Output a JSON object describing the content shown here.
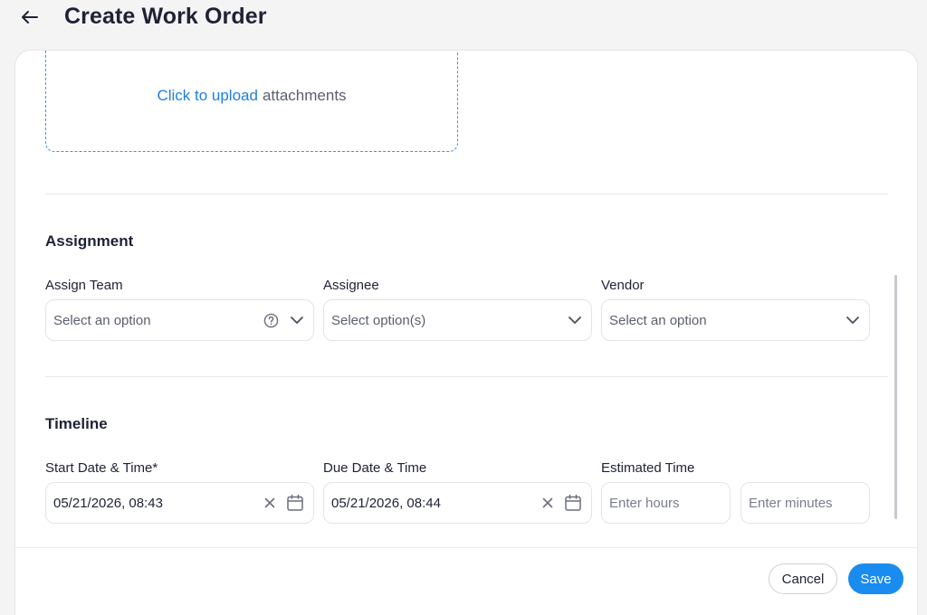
{
  "header": {
    "title": "Create Work Order",
    "back_icon": "arrow-left-icon"
  },
  "upload": {
    "link_text": "Click to upload",
    "rest_text": "attachments"
  },
  "assignment": {
    "title": "Assignment",
    "fields": [
      {
        "label": "Assign Team",
        "placeholder": "Select an option"
      },
      {
        "label": "Assignee",
        "placeholder": "Select option(s)"
      },
      {
        "label": "Vendor",
        "placeholder": "Select an option"
      }
    ]
  },
  "timeline": {
    "title": "Timeline",
    "start": {
      "label": "Start Date & Time*",
      "value": "05/21/2026, 08:43"
    },
    "due": {
      "label": "Due Date & Time",
      "value": "05/21/2026, 08:44"
    },
    "estimated": {
      "label": "Estimated Time",
      "hours_placeholder": "Enter hours",
      "minutes_placeholder": "Enter minutes"
    }
  },
  "footer": {
    "cancel_label": "Cancel",
    "save_label": "Save"
  },
  "colors": {
    "accent": "#1a8cf0",
    "link": "#1f7fe0",
    "text": "#1e2235",
    "background": "#f4f4f5"
  }
}
